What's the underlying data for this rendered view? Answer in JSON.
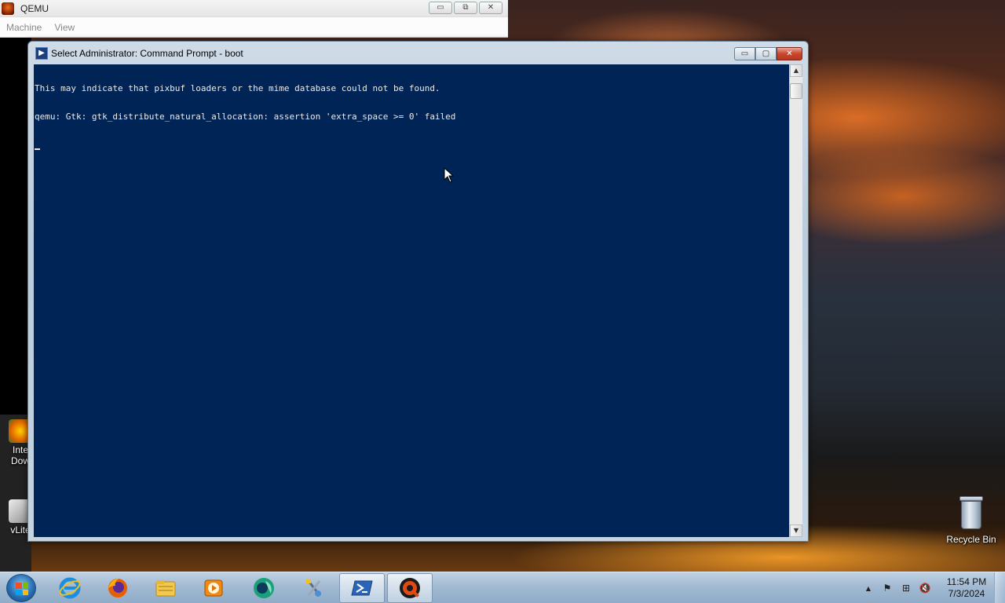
{
  "qemu": {
    "title": "QEMU",
    "menu": [
      "Machine",
      "View"
    ],
    "buttons": {
      "minimize": "▭",
      "restore": "⧉",
      "close": "✕"
    }
  },
  "cmd": {
    "title": "Select Administrator:  Command Prompt - boot",
    "icon_glyph": "▶",
    "lines": [
      "This may indicate that pixbuf loaders or the mime database could not be found.",
      "qemu: Gtk: gtk_distribute_natural_allocation: assertion 'extra_space >= 0' failed"
    ],
    "buttons": {
      "minimize": "▭",
      "maximize": "▢",
      "close": "✕"
    },
    "background": "#012456",
    "foreground": "#EAEAEA"
  },
  "desktop": {
    "icons": {
      "recycle_bin": "Recycle Bin",
      "inte_line1": "Inte",
      "inte_line2": "Dow",
      "vlite": "vLite"
    }
  },
  "taskbar": {
    "items": [
      {
        "name": "internet-explorer",
        "icon": "internet-explorer-icon"
      },
      {
        "name": "firefox",
        "icon": "firefox-icon"
      },
      {
        "name": "file-explorer",
        "icon": "folder-icon"
      },
      {
        "name": "media-player",
        "icon": "media-player-icon"
      },
      {
        "name": "app-green",
        "icon": "green-app-icon"
      },
      {
        "name": "tools",
        "icon": "tools-icon"
      },
      {
        "name": "powershell",
        "icon": "powershell-icon"
      },
      {
        "name": "qemu",
        "icon": "qemu-icon"
      }
    ],
    "tray": {
      "chevron": "▲",
      "flag": "⚑",
      "network": "⊞",
      "volume": "🔇"
    },
    "clock": {
      "time": "11:54 PM",
      "date": "7/3/2024"
    }
  }
}
